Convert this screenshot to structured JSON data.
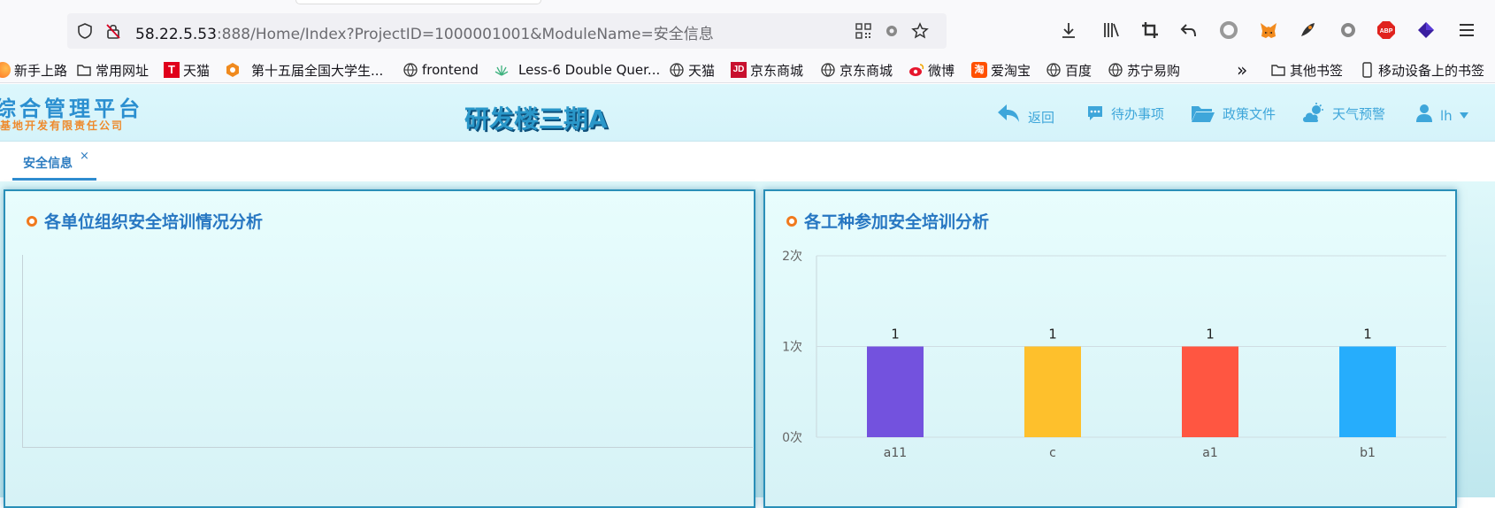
{
  "browser": {
    "url_host": "58.22.5.53",
    "url_rest": ":888/Home/Index?ProjectID=1000001001&ModuleName=安全信息",
    "toolbar_icons": [
      "download-icon",
      "library-icon",
      "crop-icon",
      "undo-icon",
      "circle-extension-icon",
      "metamask-icon",
      "rocket-extension-icon",
      "sync-extension-icon",
      "adblock-icon",
      "diamond-extension-icon",
      "menu-icon"
    ]
  },
  "bookmarks": [
    {
      "label": "新手上路",
      "icon": "firefox-icon"
    },
    {
      "label": "常用网址",
      "icon": "folder-icon"
    },
    {
      "label": "天猫",
      "icon": "tmall-icon"
    },
    {
      "label": "第十五届全国大学生...",
      "icon": "contest-icon"
    },
    {
      "label": "frontend",
      "icon": "globe-icon"
    },
    {
      "label": "Less-6 Double Quer...",
      "icon": "leaf-icon"
    },
    {
      "label": "天猫",
      "icon": "globe-icon"
    },
    {
      "label": "京东商城",
      "icon": "jd-icon"
    },
    {
      "label": "京东商城",
      "icon": "globe-icon"
    },
    {
      "label": "微博",
      "icon": "weibo-icon"
    },
    {
      "label": "爱淘宝",
      "icon": "taobao-icon"
    },
    {
      "label": "百度",
      "icon": "globe-icon"
    },
    {
      "label": "苏宁易购",
      "icon": "globe-icon"
    }
  ],
  "bookmarks_more": "»",
  "bookmarks_right": [
    {
      "label": "其他书签",
      "icon": "folder-icon"
    },
    {
      "label": "移动设备上的书签",
      "icon": "mobile-icon"
    }
  ],
  "app": {
    "logo_main": "综合管理平台",
    "logo_sub": "基地开发有限责任公司",
    "title": "研发楼三期A",
    "nav": [
      {
        "label": "返回",
        "icon": "back-icon"
      },
      {
        "label": "待办事项",
        "icon": "chat-icon"
      },
      {
        "label": "政策文件",
        "icon": "folder-open-icon"
      },
      {
        "label": "天气预警",
        "icon": "weather-icon"
      },
      {
        "label": "lh",
        "icon": "user-icon"
      }
    ],
    "tab": {
      "label": "安全信息",
      "close": "×"
    }
  },
  "panels": {
    "left_title": "各单位组织安全培训情况分析",
    "right_title": "各工种参加安全培训分析"
  },
  "chart_data": {
    "type": "bar",
    "title": "各工种参加安全培训分析",
    "categories": [
      "a11",
      "c",
      "a1",
      "b1"
    ],
    "values": [
      1,
      1,
      1,
      1
    ],
    "data_labels": [
      "1",
      "1",
      "1",
      "1"
    ],
    "bar_colors": [
      "#7352de",
      "#fec02c",
      "#ff5641",
      "#26adfc"
    ],
    "yticks": [
      "0次",
      "1次",
      "2次"
    ],
    "ylim": [
      0,
      2
    ],
    "grid": true
  }
}
